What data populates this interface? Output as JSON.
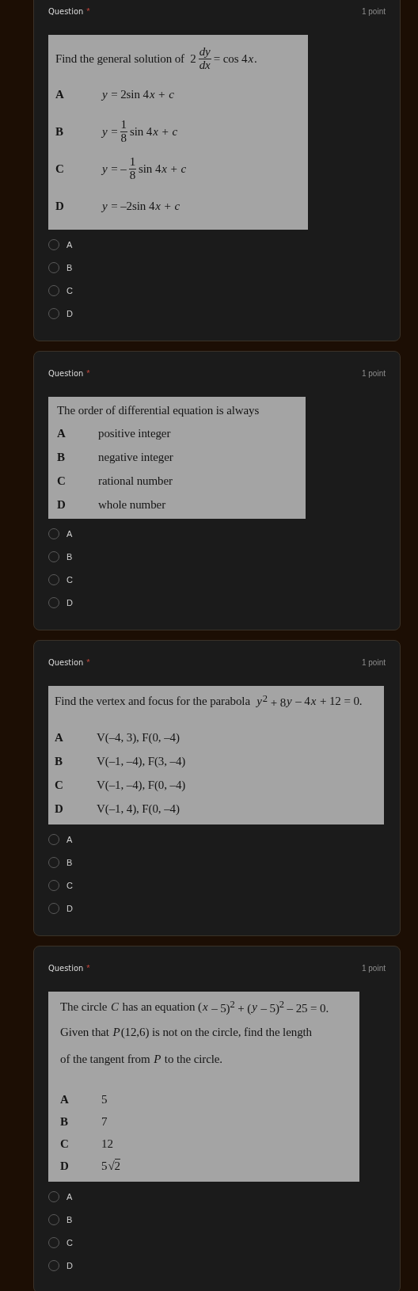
{
  "questions": [
    {
      "title": "Question",
      "required_mark": "*",
      "points": "1 point",
      "prompt": [
        [
          {
            "kind": "text",
            "text": "Find the general solution of  2"
          },
          {
            "kind": "frac",
            "num": "*dy*",
            "den": "*dx*"
          },
          {
            "kind": "text",
            "text": "= cos 4"
          },
          {
            "kind": "var",
            "text": "x"
          },
          {
            "kind": "text",
            "text": "."
          }
        ]
      ],
      "options": [
        {
          "letter": "A",
          "answer": [
            {
              "kind": "var",
              "text": "y"
            },
            {
              "kind": "text",
              "text": " = 2sin 4"
            },
            {
              "kind": "var",
              "text": "x"
            },
            {
              "kind": "text",
              "text": " + "
            },
            {
              "kind": "var",
              "text": "c"
            }
          ]
        },
        {
          "letter": "B",
          "answer": [
            {
              "kind": "var",
              "text": "y"
            },
            {
              "kind": "text",
              "text": " ="
            },
            {
              "kind": "frac",
              "num": "1",
              "den": "8"
            },
            {
              "kind": "text",
              "text": "sin 4"
            },
            {
              "kind": "var",
              "text": "x"
            },
            {
              "kind": "text",
              "text": " + "
            },
            {
              "kind": "var",
              "text": "c"
            }
          ]
        },
        {
          "letter": "C",
          "answer": [
            {
              "kind": "var",
              "text": "y"
            },
            {
              "kind": "text",
              "text": " = –"
            },
            {
              "kind": "frac",
              "num": "1",
              "den": "8"
            },
            {
              "kind": "text",
              "text": "sin 4"
            },
            {
              "kind": "var",
              "text": "x"
            },
            {
              "kind": "text",
              "text": " + "
            },
            {
              "kind": "var",
              "text": "c"
            }
          ]
        },
        {
          "letter": "D",
          "answer": [
            {
              "kind": "var",
              "text": "y"
            },
            {
              "kind": "text",
              "text": " = –2sin 4"
            },
            {
              "kind": "var",
              "text": "x"
            },
            {
              "kind": "text",
              "text": " + "
            },
            {
              "kind": "var",
              "text": "c"
            }
          ]
        }
      ],
      "choices": [
        {
          "label": "A",
          "selected": false
        },
        {
          "label": "B",
          "selected": false
        },
        {
          "label": "C",
          "selected": false
        },
        {
          "label": "D",
          "selected": false
        }
      ]
    },
    {
      "title": "Question",
      "required_mark": "*",
      "points": "1 point",
      "prompt": [
        [
          {
            "kind": "text",
            "text": "The order of differential equation is always"
          }
        ]
      ],
      "options": [
        {
          "letter": "A",
          "answer": [
            {
              "kind": "text",
              "text": "positive integer"
            }
          ]
        },
        {
          "letter": "B",
          "answer": [
            {
              "kind": "text",
              "text": "negative integer"
            }
          ]
        },
        {
          "letter": "C",
          "answer": [
            {
              "kind": "text",
              "text": "rational number"
            }
          ]
        },
        {
          "letter": "D",
          "answer": [
            {
              "kind": "text",
              "text": "whole number"
            }
          ]
        }
      ],
      "choices": [
        {
          "label": "A",
          "selected": false
        },
        {
          "label": "B",
          "selected": false
        },
        {
          "label": "C",
          "selected": false
        },
        {
          "label": "D",
          "selected": false
        }
      ]
    },
    {
      "title": "Question",
      "required_mark": "*",
      "points": "1 point",
      "prompt": [
        [
          {
            "kind": "text",
            "text": "Find the vertex and focus for the parabola  "
          },
          {
            "kind": "var",
            "text": "y"
          },
          {
            "kind": "text",
            "text": "$^{2}$ + 8"
          },
          {
            "kind": "var",
            "text": "y"
          },
          {
            "kind": "text",
            "text": " – 4"
          },
          {
            "kind": "var",
            "text": "x"
          },
          {
            "kind": "text",
            "text": " + 12 = 0."
          }
        ]
      ],
      "options": [
        {
          "letter": "A",
          "answer": [
            {
              "kind": "text",
              "text": "V(–4, 3), F(0, –4)"
            }
          ]
        },
        {
          "letter": "B",
          "answer": [
            {
              "kind": "text",
              "text": "V(–1, –4), F(3, –4)"
            }
          ]
        },
        {
          "letter": "C",
          "answer": [
            {
              "kind": "text",
              "text": "V(–1, –4), F(0, –4)"
            }
          ]
        },
        {
          "letter": "D",
          "answer": [
            {
              "kind": "text",
              "text": "V(–1, 4), F(0, –4)"
            }
          ]
        }
      ],
      "choices": [
        {
          "label": "A",
          "selected": false
        },
        {
          "label": "B",
          "selected": false
        },
        {
          "label": "C",
          "selected": false
        },
        {
          "label": "D",
          "selected": false
        }
      ]
    },
    {
      "title": "Question",
      "required_mark": "*",
      "points": "1 point",
      "prompt": [
        [
          {
            "kind": "text",
            "text": "The circle "
          },
          {
            "kind": "var",
            "text": "C"
          },
          {
            "kind": "text",
            "text": " has an equation ("
          },
          {
            "kind": "var",
            "text": "x"
          },
          {
            "kind": "text",
            "text": " – 5)$^{2}$ + ("
          },
          {
            "kind": "var",
            "text": "y"
          },
          {
            "kind": "text",
            "text": " – 5)$^{2}$ – 25 = 0."
          }
        ],
        [
          {
            "kind": "text",
            "text": "Given that "
          },
          {
            "kind": "var",
            "text": "P"
          },
          {
            "kind": "text",
            "text": "(12,6) is not on the circle, find the length"
          }
        ],
        [
          {
            "kind": "text",
            "text": "of the tangent from "
          },
          {
            "kind": "var",
            "text": "P"
          },
          {
            "kind": "text",
            "text": " to the circle."
          }
        ]
      ],
      "options": [
        {
          "letter": "A",
          "answer": [
            {
              "kind": "text",
              "text": "5"
            }
          ]
        },
        {
          "letter": "B",
          "answer": [
            {
              "kind": "text",
              "text": "7"
            }
          ]
        },
        {
          "letter": "C",
          "answer": [
            {
              "kind": "text",
              "text": "12"
            }
          ]
        },
        {
          "letter": "D",
          "answer": [
            {
              "kind": "text",
              "text": "5"
            },
            {
              "kind": "sqrt",
              "sign": "√",
              "text": "2"
            }
          ]
        }
      ],
      "choices": [
        {
          "label": "A",
          "selected": false
        },
        {
          "label": "B",
          "selected": false
        },
        {
          "label": "C",
          "selected": false
        },
        {
          "label": "D",
          "selected": false
        }
      ]
    }
  ]
}
